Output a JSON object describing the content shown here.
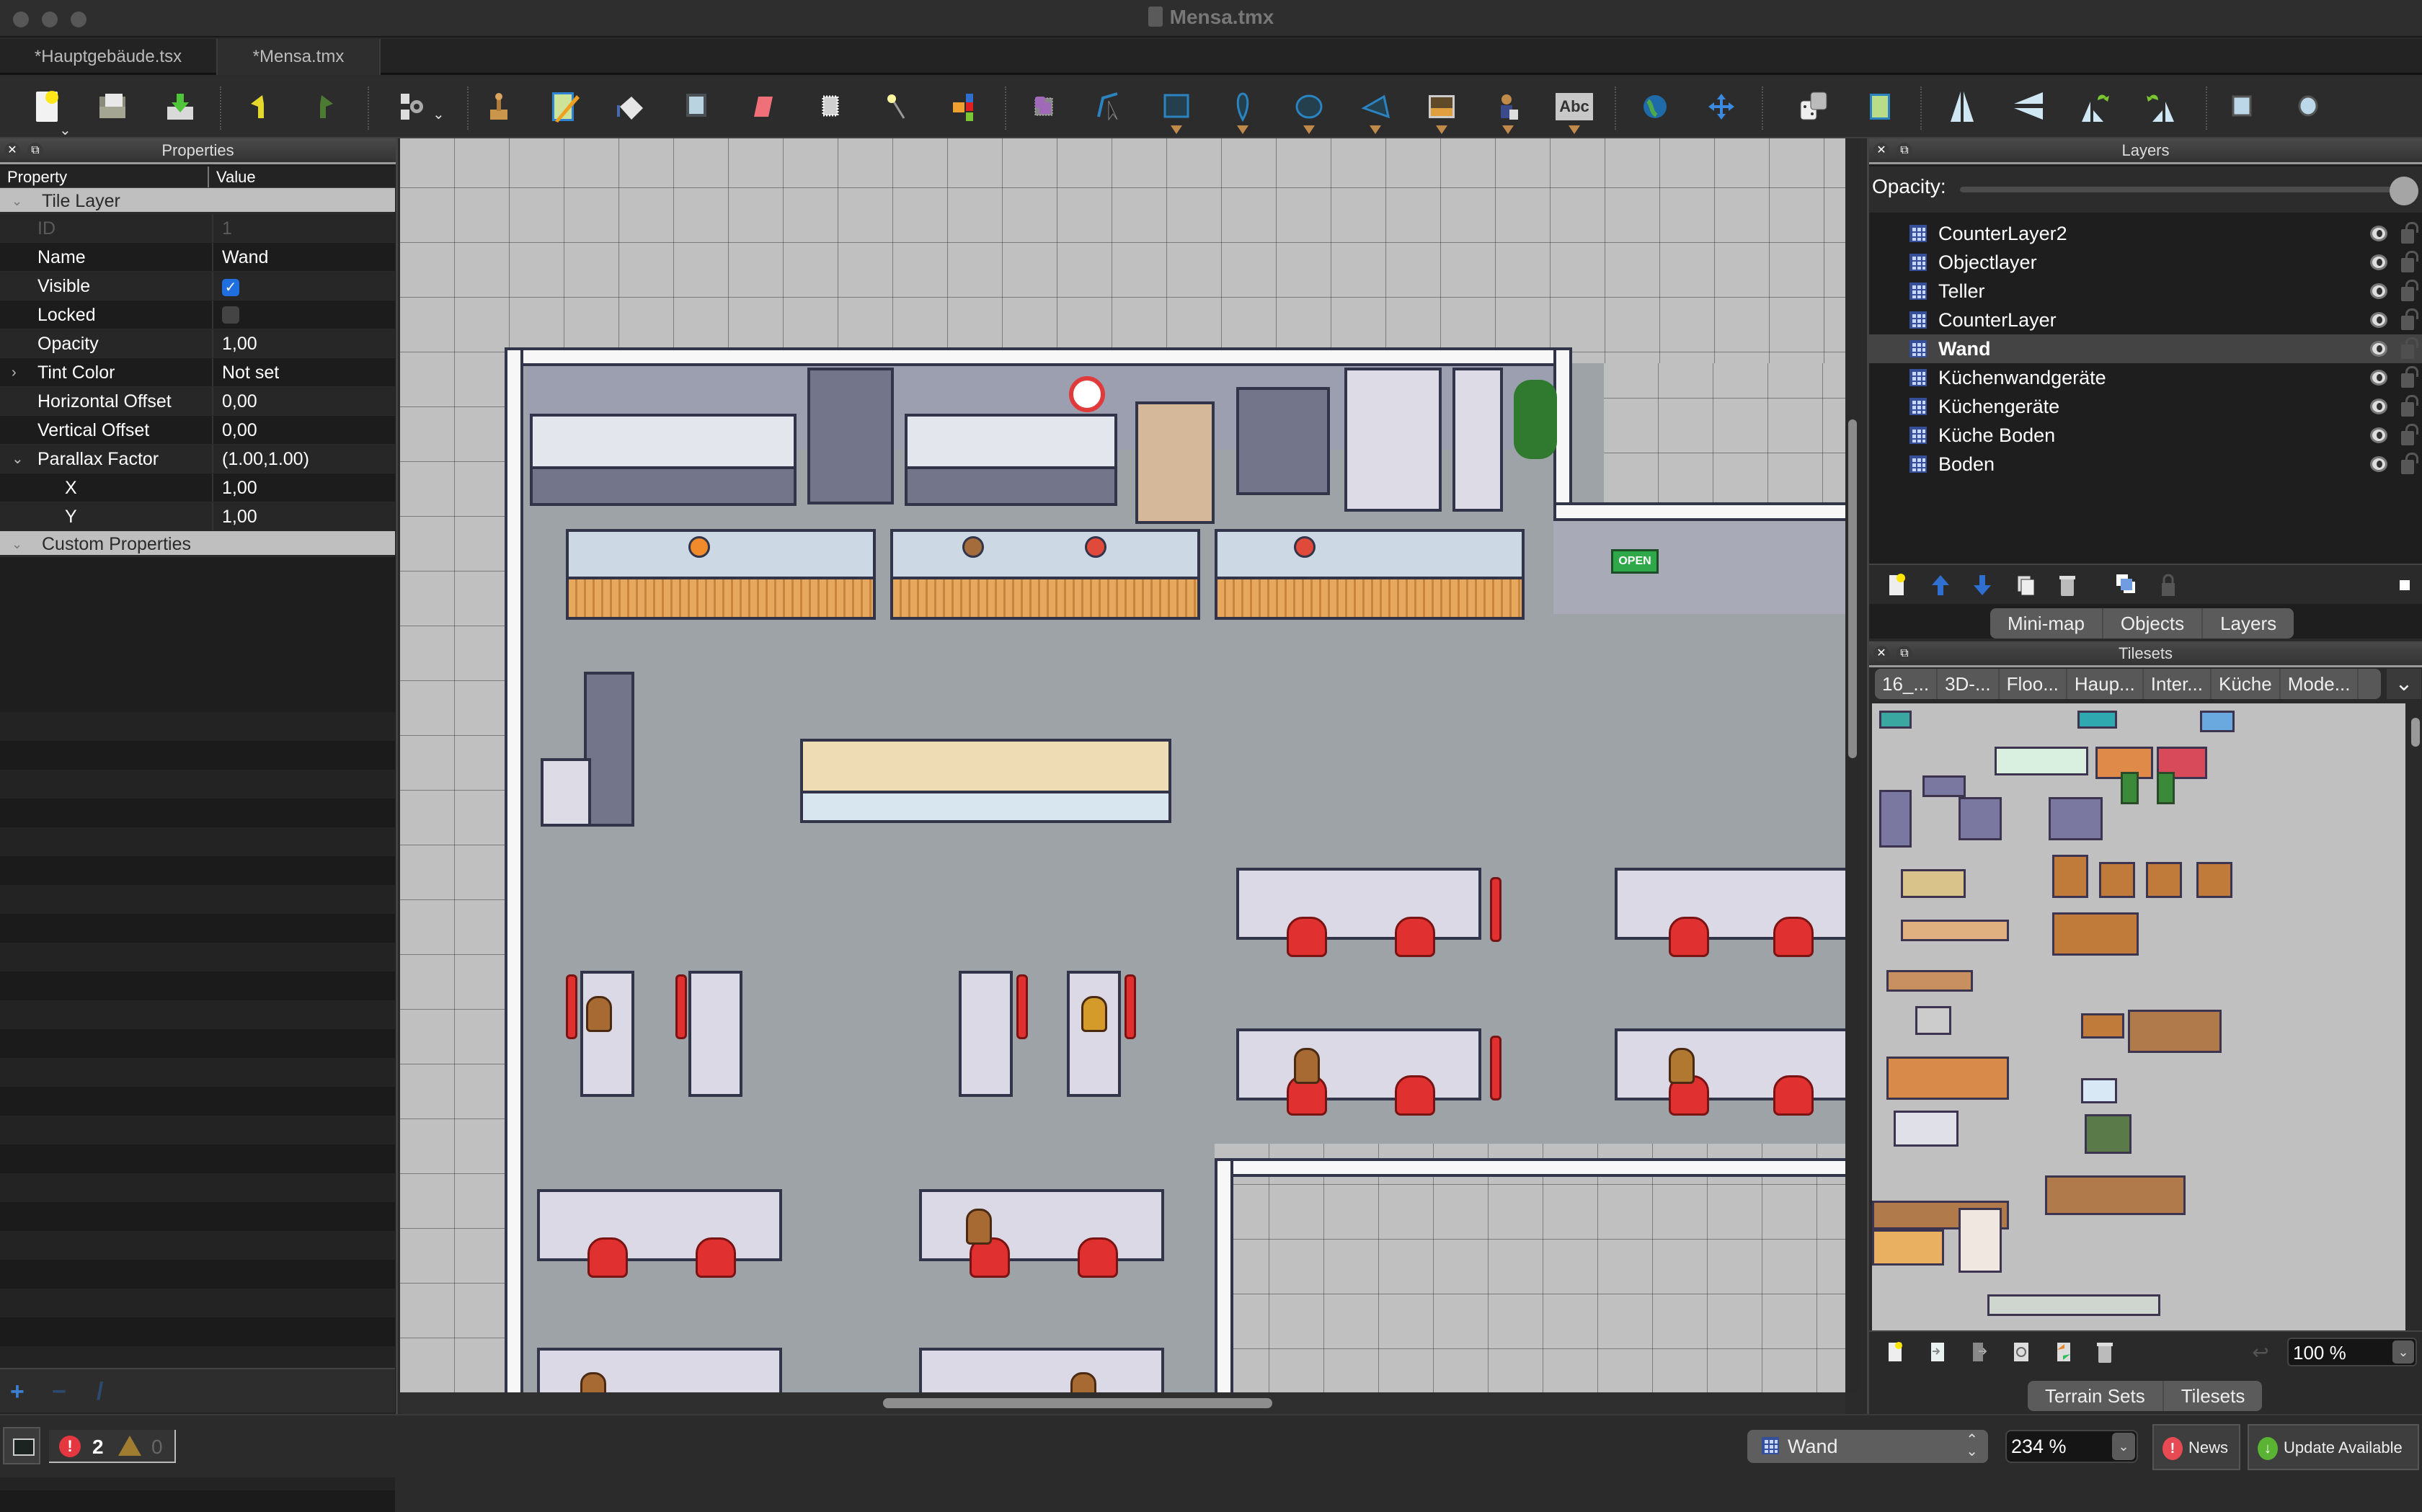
{
  "window": {
    "title": "Mensa.tmx",
    "file_icon": "tmx-file-icon"
  },
  "doc_tabs": [
    {
      "label": "*Hauptgebäude.tsx",
      "active": false
    },
    {
      "label": "*Mensa.tmx",
      "active": true
    }
  ],
  "toolbar": {
    "groups": [
      [
        {
          "name": "new-file-icon",
          "dropdown": true
        },
        {
          "name": "open-file-icon"
        },
        {
          "name": "save-file-icon"
        }
      ],
      [
        {
          "name": "undo-icon"
        },
        {
          "name": "redo-icon"
        }
      ],
      [
        {
          "name": "commands-icon",
          "dropdown": true
        }
      ],
      [
        {
          "name": "stamp-brush-icon"
        },
        {
          "name": "terrain-brush-icon"
        },
        {
          "name": "bucket-fill-icon"
        },
        {
          "name": "shape-fill-icon"
        },
        {
          "name": "eraser-icon"
        },
        {
          "name": "rectangular-select-icon"
        },
        {
          "name": "magic-wand-icon"
        },
        {
          "name": "select-same-tile-icon"
        }
      ],
      [
        {
          "name": "select-objects-icon"
        },
        {
          "name": "edit-polygons-icon"
        },
        {
          "name": "insert-rectangle-icon"
        },
        {
          "name": "insert-point-icon"
        },
        {
          "name": "insert-ellipse-icon"
        },
        {
          "name": "insert-polygon-icon"
        },
        {
          "name": "insert-tile-icon"
        },
        {
          "name": "insert-template-icon"
        },
        {
          "name": "insert-text-icon",
          "text": "Abc"
        }
      ],
      [
        {
          "name": "world-tool-icon"
        },
        {
          "name": "move-layer-icon"
        }
      ],
      [
        {
          "name": "random-mode-icon"
        },
        {
          "name": "wang-fill-icon"
        }
      ],
      [
        {
          "name": "flip-horizontal-icon"
        },
        {
          "name": "flip-vertical-icon"
        },
        {
          "name": "rotate-left-icon"
        },
        {
          "name": "rotate-right-icon"
        }
      ],
      [
        {
          "name": "rectangle-shape-icon"
        },
        {
          "name": "ellipse-shape-icon"
        }
      ]
    ]
  },
  "properties_panel": {
    "title": "Properties",
    "columns": {
      "property": "Property",
      "value": "Value"
    },
    "group_tile_layer": "Tile Layer",
    "rows": [
      {
        "key": "ID",
        "value": "1",
        "disabled": true
      },
      {
        "key": "Name",
        "value": "Wand"
      },
      {
        "key": "Visible",
        "checkbox": true,
        "checked": true
      },
      {
        "key": "Locked",
        "checkbox": true,
        "checked": false
      },
      {
        "key": "Opacity",
        "value": "1,00"
      },
      {
        "key": "Tint Color",
        "value": "Not set",
        "expandable": "collapsed"
      },
      {
        "key": "Horizontal Offset",
        "value": "0,00"
      },
      {
        "key": "Vertical Offset",
        "value": "0,00"
      },
      {
        "key": "Parallax Factor",
        "value": "(1.00,1.00)",
        "expandable": "expanded"
      },
      {
        "key": "X",
        "value": "1,00",
        "sub": true
      },
      {
        "key": "Y",
        "value": "1,00",
        "sub": true
      }
    ],
    "group_custom": "Custom Properties",
    "footer": {
      "add": "+",
      "remove": "−",
      "rename": "/"
    }
  },
  "layers_panel": {
    "title": "Layers",
    "opacity_label": "Opacity:",
    "opacity_value": 1.0,
    "layers": [
      {
        "name": "CounterLayer2",
        "visible": true,
        "locked": false
      },
      {
        "name": "Objectlayer",
        "visible": true,
        "locked": false
      },
      {
        "name": "Teller",
        "visible": true,
        "locked": false
      },
      {
        "name": "CounterLayer",
        "visible": true,
        "locked": false
      },
      {
        "name": "Wand",
        "visible": true,
        "locked": false,
        "selected": true
      },
      {
        "name": "Küchenwandgeräte",
        "visible": true,
        "locked": false
      },
      {
        "name": "Küchengeräte",
        "visible": true,
        "locked": false
      },
      {
        "name": "Küche Boden",
        "visible": true,
        "locked": false
      },
      {
        "name": "Boden",
        "visible": true,
        "locked": false
      }
    ],
    "tabs": [
      "Mini-map",
      "Objects",
      "Layers"
    ]
  },
  "tilesets_panel": {
    "title": "Tilesets",
    "tabs": [
      "16_...",
      "3D-...",
      "Floo...",
      "Haup...",
      "Inter...",
      "Küche",
      "Mode..."
    ],
    "zoom": "100 %",
    "bottom_tabs": [
      "Terrain Sets",
      "Tilesets"
    ]
  },
  "statusbar": {
    "errors": "2",
    "warnings": "0",
    "current_layer": "Wand",
    "zoom": "234 %",
    "news": "News",
    "update": "Update Available"
  }
}
